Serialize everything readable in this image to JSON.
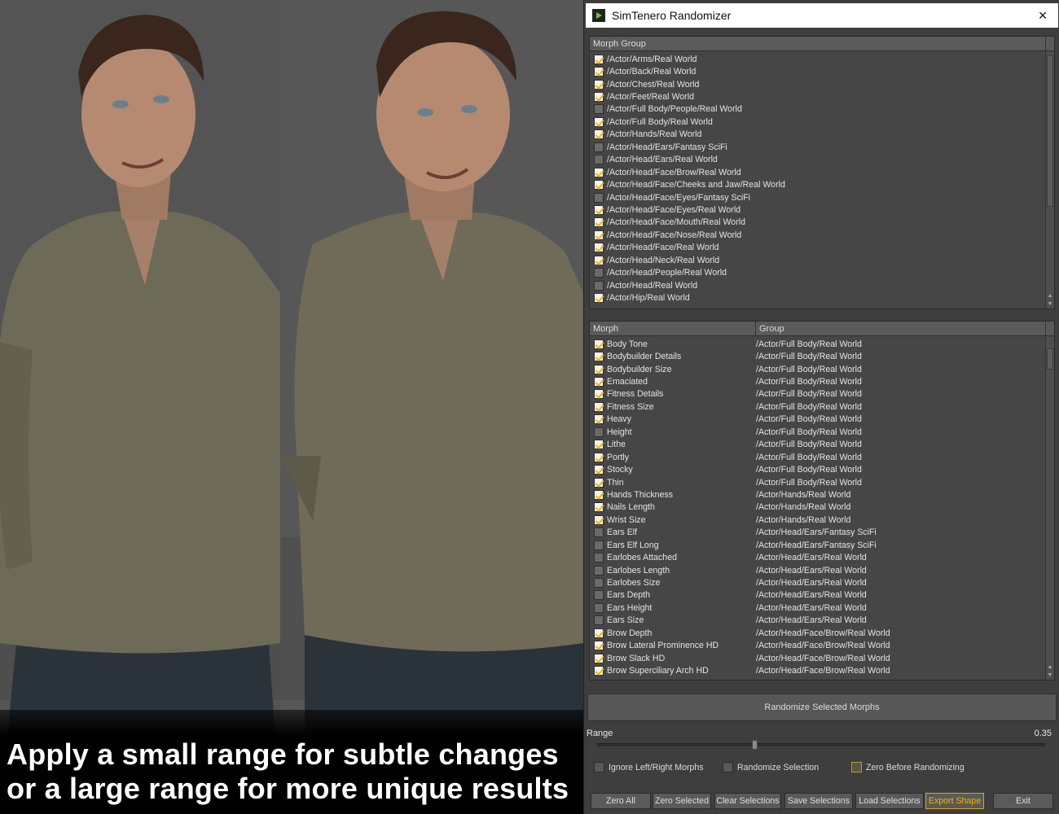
{
  "caption": {
    "line1": "Apply a small range for subtle changes",
    "line2": "or a large range for more unique results"
  },
  "window": {
    "title": "SimTenero Randomizer",
    "close_label": "×"
  },
  "morph_groups": {
    "header": "Morph Group",
    "items": [
      {
        "label": "/Actor/Arms/Real World",
        "checked": true
      },
      {
        "label": "/Actor/Back/Real World",
        "checked": true
      },
      {
        "label": "/Actor/Chest/Real World",
        "checked": true
      },
      {
        "label": "/Actor/Feet/Real World",
        "checked": true
      },
      {
        "label": "/Actor/Full Body/People/Real World",
        "checked": false
      },
      {
        "label": "/Actor/Full Body/Real World",
        "checked": true
      },
      {
        "label": "/Actor/Hands/Real World",
        "checked": true
      },
      {
        "label": "/Actor/Head/Ears/Fantasy SciFi",
        "checked": false
      },
      {
        "label": "/Actor/Head/Ears/Real World",
        "checked": false
      },
      {
        "label": "/Actor/Head/Face/Brow/Real World",
        "checked": true
      },
      {
        "label": "/Actor/Head/Face/Cheeks and Jaw/Real World",
        "checked": true
      },
      {
        "label": "/Actor/Head/Face/Eyes/Fantasy SciFi",
        "checked": false
      },
      {
        "label": "/Actor/Head/Face/Eyes/Real World",
        "checked": true
      },
      {
        "label": "/Actor/Head/Face/Mouth/Real World",
        "checked": true
      },
      {
        "label": "/Actor/Head/Face/Nose/Real World",
        "checked": true
      },
      {
        "label": "/Actor/Head/Face/Real World",
        "checked": true
      },
      {
        "label": "/Actor/Head/Neck/Real World",
        "checked": true
      },
      {
        "label": "/Actor/Head/People/Real World",
        "checked": false
      },
      {
        "label": "/Actor/Head/Real World",
        "checked": false
      },
      {
        "label": "/Actor/Hip/Real World",
        "checked": true
      }
    ]
  },
  "morphs": {
    "header_morph": "Morph",
    "header_group": "Group",
    "items": [
      {
        "morph": "Body Tone",
        "group": "/Actor/Full Body/Real World",
        "checked": true
      },
      {
        "morph": "Bodybuilder Details",
        "group": "/Actor/Full Body/Real World",
        "checked": true
      },
      {
        "morph": "Bodybuilder Size",
        "group": "/Actor/Full Body/Real World",
        "checked": true
      },
      {
        "morph": "Emaciated",
        "group": "/Actor/Full Body/Real World",
        "checked": true
      },
      {
        "morph": "Fitness Details",
        "group": "/Actor/Full Body/Real World",
        "checked": true
      },
      {
        "morph": "Fitness Size",
        "group": "/Actor/Full Body/Real World",
        "checked": true
      },
      {
        "morph": "Heavy",
        "group": "/Actor/Full Body/Real World",
        "checked": true
      },
      {
        "morph": "Height",
        "group": "/Actor/Full Body/Real World",
        "checked": false
      },
      {
        "morph": "Lithe",
        "group": "/Actor/Full Body/Real World",
        "checked": true
      },
      {
        "morph": "Portly",
        "group": "/Actor/Full Body/Real World",
        "checked": true
      },
      {
        "morph": "Stocky",
        "group": "/Actor/Full Body/Real World",
        "checked": true
      },
      {
        "morph": "Thin",
        "group": "/Actor/Full Body/Real World",
        "checked": true
      },
      {
        "morph": "Hands Thickness",
        "group": "/Actor/Hands/Real World",
        "checked": true
      },
      {
        "morph": "Nails Length",
        "group": "/Actor/Hands/Real World",
        "checked": true
      },
      {
        "morph": "Wrist Size",
        "group": "/Actor/Hands/Real World",
        "checked": true
      },
      {
        "morph": "Ears Elf",
        "group": "/Actor/Head/Ears/Fantasy SciFi",
        "checked": false
      },
      {
        "morph": "Ears Elf Long",
        "group": "/Actor/Head/Ears/Fantasy SciFi",
        "checked": false
      },
      {
        "morph": "Earlobes Attached",
        "group": "/Actor/Head/Ears/Real World",
        "checked": false
      },
      {
        "morph": "Earlobes Length",
        "group": "/Actor/Head/Ears/Real World",
        "checked": false
      },
      {
        "morph": "Earlobes Size",
        "group": "/Actor/Head/Ears/Real World",
        "checked": false
      },
      {
        "morph": "Ears Depth",
        "group": "/Actor/Head/Ears/Real World",
        "checked": false
      },
      {
        "morph": "Ears Height",
        "group": "/Actor/Head/Ears/Real World",
        "checked": false
      },
      {
        "morph": "Ears Size",
        "group": "/Actor/Head/Ears/Real World",
        "checked": false
      },
      {
        "morph": "Brow Depth",
        "group": "/Actor/Head/Face/Brow/Real World",
        "checked": true
      },
      {
        "morph": "Brow Lateral Prominence HD",
        "group": "/Actor/Head/Face/Brow/Real World",
        "checked": true
      },
      {
        "morph": "Brow Slack HD",
        "group": "/Actor/Head/Face/Brow/Real World",
        "checked": true
      },
      {
        "morph": "Brow Superciliary Arch HD",
        "group": "/Actor/Head/Face/Brow/Real World",
        "checked": true
      }
    ]
  },
  "randomize_label": "Randomize Selected Morphs",
  "range": {
    "label": "Range",
    "value_text": "0.35",
    "fraction": 0.35
  },
  "options": {
    "ignore_lr": "Ignore Left/Right Morphs",
    "randomize_selection": "Randomize Selection",
    "zero_before": "Zero Before Randomizing"
  },
  "buttons": {
    "zero_all": "Zero All",
    "zero_selected": "Zero Selected",
    "clear_selections": "Clear Selections",
    "save_selections": "Save Selections",
    "load_selections": "Load Selections",
    "export_shape": "Export Shape",
    "exit": "Exit"
  },
  "colors": {
    "accent": "#f5b400",
    "dialog_bg": "#3e3e3e"
  }
}
